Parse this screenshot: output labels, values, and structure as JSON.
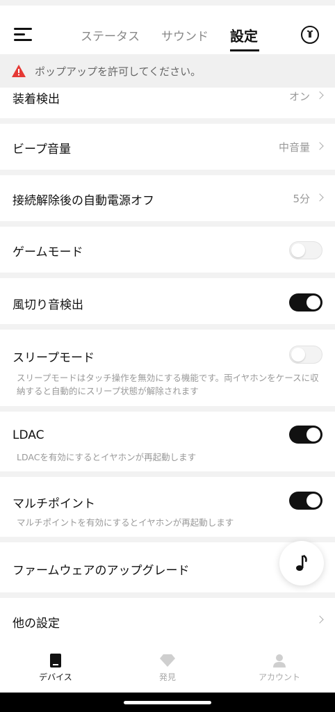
{
  "header": {
    "tabs": [
      {
        "label": "ステータス",
        "active": false
      },
      {
        "label": "サウンド",
        "active": false
      },
      {
        "label": "設定",
        "active": true
      }
    ]
  },
  "alert": {
    "text": "ポップアップを許可してください。",
    "color": "#e53935"
  },
  "settings": [
    {
      "label": "装着検出",
      "value": "オン"
    },
    {
      "label": "ビープ音量",
      "value": "中音量"
    },
    {
      "label": "接続解除後の自動電源オフ",
      "value": "5分"
    },
    {
      "label": "ゲームモード",
      "toggle": false
    },
    {
      "label": "風切り音検出",
      "toggle": true
    },
    {
      "label": "スリープモード",
      "toggle": false,
      "description": "スリープモードはタッチ操作を無効にする機能です。両イヤホンをケースに収納すると自動的にスリープ状態が解除されます"
    },
    {
      "label": "LDAC",
      "toggle": true,
      "description": "LDACを有効にするとイヤホンが再起動します"
    },
    {
      "label": "マルチポイント",
      "toggle": true,
      "description": "マルチポイントを有効にするとイヤホンが再起動します"
    },
    {
      "label": "ファームウェアのアップグレード"
    },
    {
      "label": "他の設定"
    }
  ],
  "bottom_nav": [
    {
      "label": "デバイス",
      "icon": "device-icon",
      "active": true
    },
    {
      "label": "発見",
      "icon": "diamond-icon",
      "active": false
    },
    {
      "label": "アカウント",
      "icon": "person-icon",
      "active": false
    }
  ],
  "colors": {
    "accent": "#111111",
    "muted": "#999999"
  }
}
